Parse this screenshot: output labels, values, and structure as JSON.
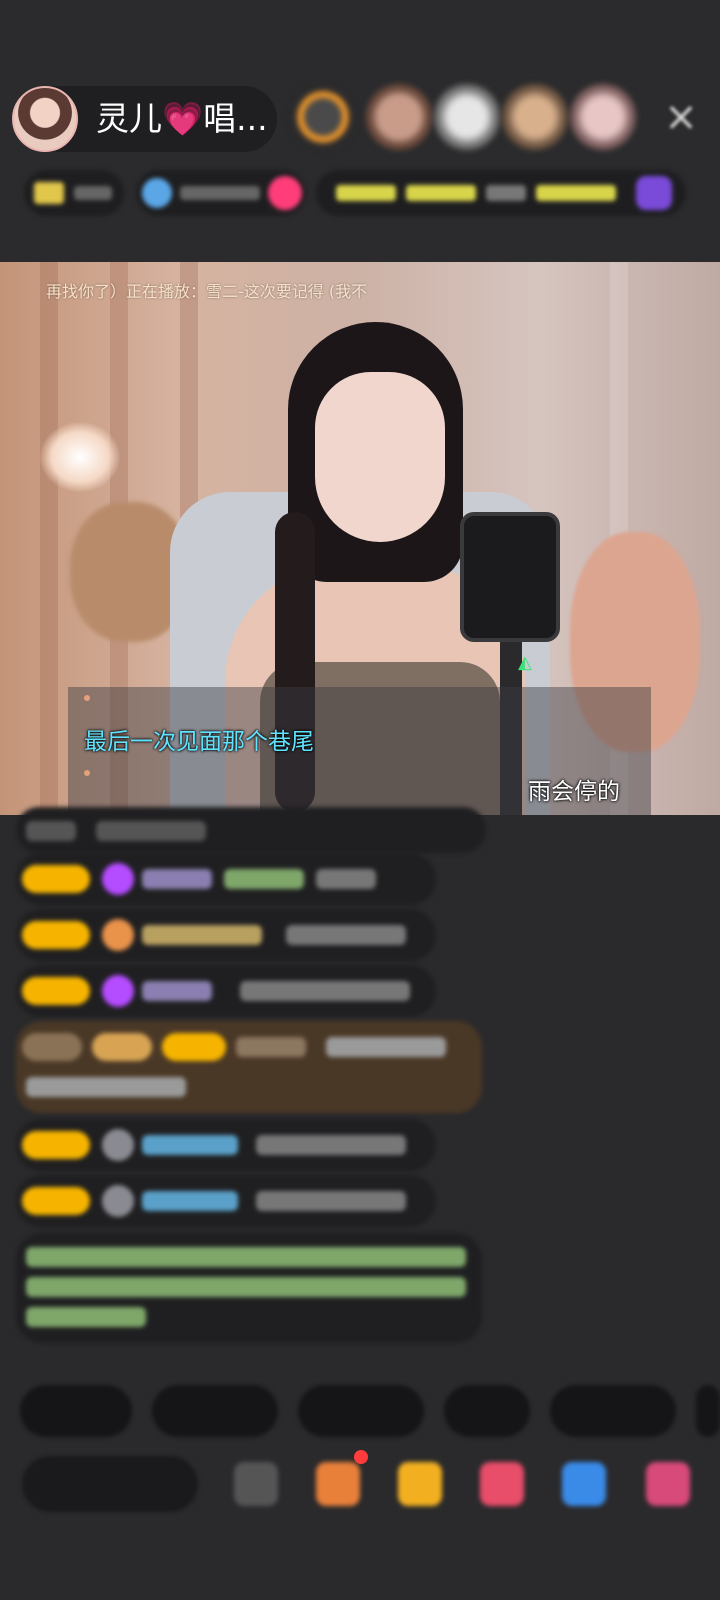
{
  "header": {
    "host_name": "灵儿💗唱..."
  },
  "video": {
    "now_playing": "再找你了）正在播放：雪二-这次要记得 (我不",
    "lyrics": {
      "line_1": "最后一次见面那个巷尾",
      "line_2": "雨会停的"
    }
  },
  "colors": {
    "lyric_primary": "#5fe3ff",
    "lyric_secondary": "#ffffff",
    "level_badge": "#f6b400",
    "gem": "#b44cff"
  },
  "icons": [
    "close-icon",
    "gift-icon",
    "emoji-icon",
    "more-icon"
  ]
}
